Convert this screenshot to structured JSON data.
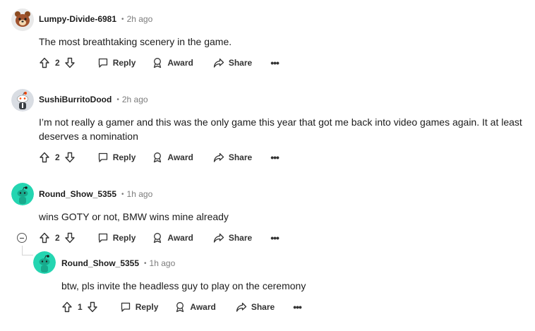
{
  "comments": [
    {
      "author": "Lumpy-Divide-6981",
      "time": "2h ago",
      "text": "The most breathtaking scenery in the game.",
      "votes": "2",
      "reply_label": "Reply",
      "award_label": "Award",
      "share_label": "Share",
      "more_label": "•••",
      "separator": "•",
      "avatar": {
        "icon": "snoo-bear-avatar",
        "color": "#a0522d"
      }
    },
    {
      "author": "SushiBurritoDood",
      "time": "2h ago",
      "text": "I’m not really a gamer and this was the only game this year that got me back into video games again. It at least deserves a nomination",
      "votes": "2",
      "reply_label": "Reply",
      "award_label": "Award",
      "share_label": "Share",
      "more_label": "•••",
      "separator": "•",
      "avatar": {
        "icon": "snoo-avatar",
        "color": "#d9dde3"
      }
    },
    {
      "author": "Round_Show_5355",
      "time": "1h ago",
      "text": "wins GOTY or not, BMW wins mine already",
      "votes": "2",
      "reply_label": "Reply",
      "award_label": "Award",
      "share_label": "Share",
      "more_label": "•••",
      "separator": "•",
      "avatar": {
        "icon": "snoo-avatar",
        "color": "#24d5b1"
      }
    },
    {
      "author": "Round_Show_5355",
      "time": "1h ago",
      "text": "btw, pls invite the headless guy to play on the ceremony",
      "votes": "1",
      "reply_label": "Reply",
      "award_label": "Award",
      "share_label": "Share",
      "more_label": "•••",
      "separator": "•",
      "avatar": {
        "icon": "snoo-avatar",
        "color": "#24d5b1"
      }
    }
  ]
}
